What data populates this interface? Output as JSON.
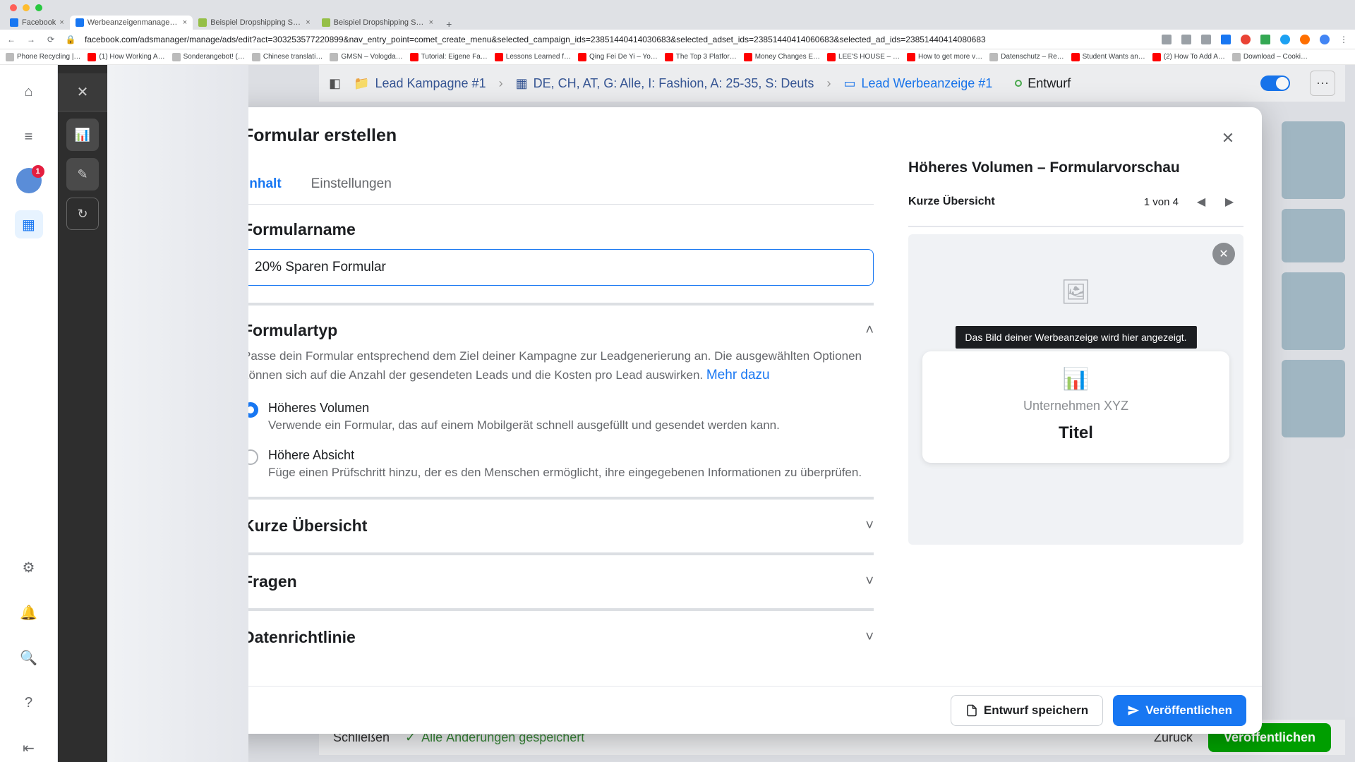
{
  "chrome": {
    "tabs": [
      {
        "label": "Facebook"
      },
      {
        "label": "Werbeanzeigenmanager – We"
      },
      {
        "label": "Beispiel Dropshipping Store"
      },
      {
        "label": "Beispiel Dropshipping Store"
      }
    ],
    "url": "facebook.com/adsmanager/manage/ads/edit?act=303253577220899&nav_entry_point=comet_create_menu&selected_campaign_ids=23851440414030683&selected_adset_ids=23851440414060683&selected_ad_ids=23851440414080683",
    "bookmarks": [
      "Phone Recycling |…",
      "(1) How Working A…",
      "Sonderangebot! (…",
      "Chinese translati…",
      "GMSN – Vologda…",
      "Tutorial: Eigene Fa…",
      "Lessons Learned f…",
      "Qing Fei De Yi – Yo…",
      "The Top 3 Platfor…",
      "Money Changes E…",
      "LEE'S HOUSE – …",
      "How to get more v…",
      "Datenschutz – Re…",
      "Student Wants an…",
      "(2) How To Add A…",
      "Download – Cooki…"
    ]
  },
  "railBadge": "1",
  "breadcrumb": {
    "campaign": "Lead Kampagne #1",
    "adset": "DE, CH, AT, G: Alle, I: Fashion, A: 25-35, S: Deuts",
    "ad": "Lead Werbeanzeige #1",
    "status": "Entwurf"
  },
  "footer": {
    "close": "Schließen",
    "saved": "Alle Änderungen gespeichert",
    "back": "Zurück",
    "publish": "Veröffentlichen"
  },
  "modal": {
    "title": "Formular erstellen",
    "tabs": {
      "content": "Inhalt",
      "settings": "Einstellungen"
    },
    "formName": {
      "heading": "Formularname",
      "value": "20% Sparen Formular"
    },
    "formType": {
      "heading": "Formulartyp",
      "desc": "Passe dein Formular entsprechend dem Ziel deiner Kampagne zur Leadgenerierung an. Die ausgewählten Optionen können sich auf die Anzahl der gesendeten Leads und die Kosten pro Lead auswirken. ",
      "more": "Mehr dazu",
      "opt1": {
        "label": "Höheres Volumen",
        "desc": "Verwende ein Formular, das auf einem Mobilgerät schnell ausgefüllt und gesendet werden kann."
      },
      "opt2": {
        "label": "Höhere Absicht",
        "desc": "Füge einen Prüfschritt hinzu, der es den Menschen ermöglicht, ihre eingegebenen Informationen zu überprüfen."
      }
    },
    "sections": {
      "overview": "Kurze Übersicht",
      "questions": "Fragen",
      "privacy": "Datenrichtlinie"
    },
    "actions": {
      "draft": "Entwurf speichern",
      "publish": "Veröffentlichen"
    }
  },
  "preview": {
    "title": "Höheres Volumen – Formularvorschau",
    "tabLabel": "Kurze Übersicht",
    "counter": "1 von 4",
    "tooltip": "Das Bild deiner Werbeanzeige wird hier angezeigt.",
    "org": "Unternehmen XYZ",
    "cardTitle": "Titel"
  }
}
